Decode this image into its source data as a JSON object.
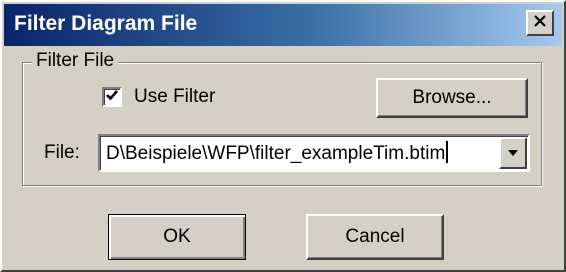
{
  "window": {
    "title": "Filter Diagram File",
    "close_icon": "close-icon"
  },
  "group": {
    "label": "Filter File"
  },
  "use_filter": {
    "label": "Use Filter",
    "checked": true
  },
  "browse_button": {
    "label": "Browse..."
  },
  "file": {
    "label": "File:",
    "value": "D\\Beispiele\\WFP\\filter_exampleTim.btim"
  },
  "buttons": {
    "ok": "OK",
    "cancel": "Cancel"
  },
  "colors": {
    "titlebar_start": "#0a246a",
    "titlebar_end": "#a6caf0",
    "face": "#d4d0c8"
  }
}
